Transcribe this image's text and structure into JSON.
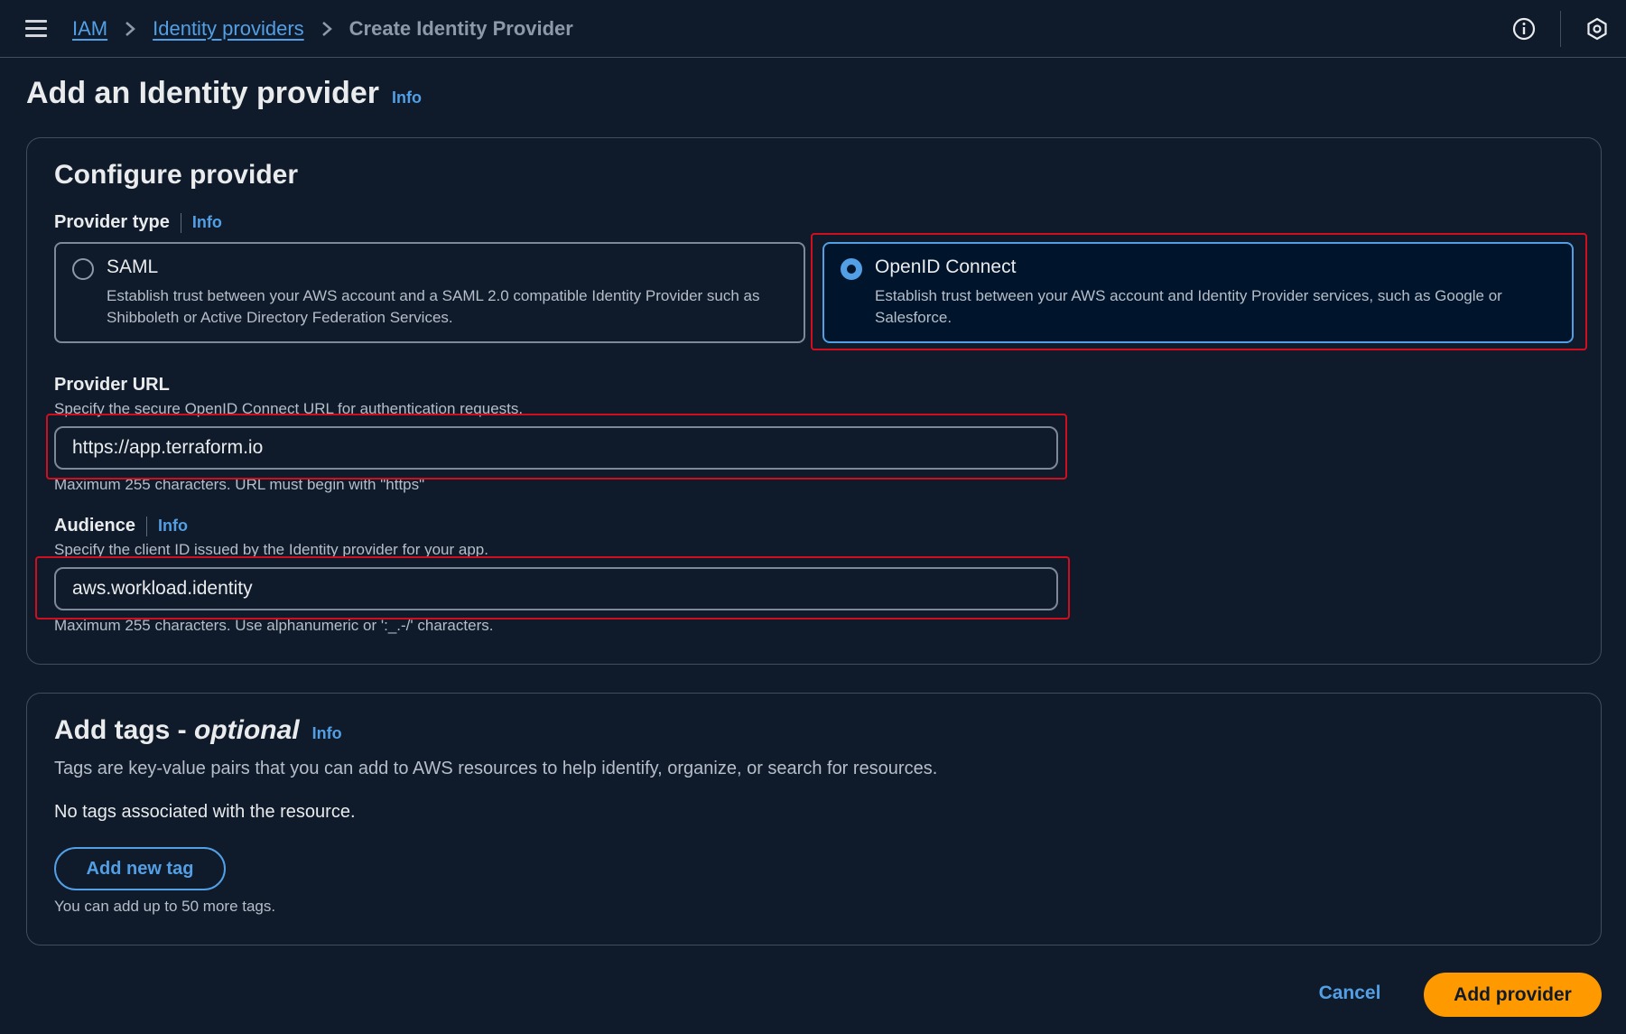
{
  "breadcrumb": {
    "items": [
      "IAM",
      "Identity providers"
    ],
    "current": "Create Identity Provider"
  },
  "icons": {
    "menu": "hamburger-menu-icon",
    "separator": "chevron-right-icon",
    "info": "info-circle-icon",
    "settings": "hexagon-settings-icon"
  },
  "page": {
    "title": "Add an Identity provider",
    "info": "Info"
  },
  "configure": {
    "title": "Configure provider",
    "provider_type": {
      "label": "Provider type",
      "info": "Info",
      "options": [
        {
          "title": "SAML",
          "description": "Establish trust between your AWS account and a SAML 2.0 compatible Identity Provider such as Shibboleth or Active Directory Federation Services.",
          "selected": false
        },
        {
          "title": "OpenID Connect",
          "description": "Establish trust between your AWS account and Identity Provider services, such as Google or Salesforce.",
          "selected": true
        }
      ]
    },
    "provider_url": {
      "label": "Provider URL",
      "description": "Specify the secure OpenID Connect URL for authentication requests.",
      "value": "https://app.terraform.io",
      "hint": "Maximum 255 characters. URL must begin with \"https\""
    },
    "audience": {
      "label": "Audience",
      "info": "Info",
      "description": "Specify the client ID issued by the Identity provider for your app.",
      "value": "aws.workload.identity",
      "hint": "Maximum 255 characters. Use alphanumeric or ':_.-/' characters."
    }
  },
  "tags": {
    "title_main": "Add tags - ",
    "title_optional": "optional",
    "info": "Info",
    "description": "Tags are key-value pairs that you can add to AWS resources to help identify, organize, or search for resources.",
    "empty": "No tags associated with the resource.",
    "add_button": "Add new tag",
    "limit": "You can add up to 50 more tags."
  },
  "footer": {
    "cancel": "Cancel",
    "submit": "Add provider"
  },
  "colors": {
    "background": "#0f1b2a",
    "accent": "#539fe5",
    "primary": "#ff9900",
    "highlight": "#d10e1e"
  }
}
